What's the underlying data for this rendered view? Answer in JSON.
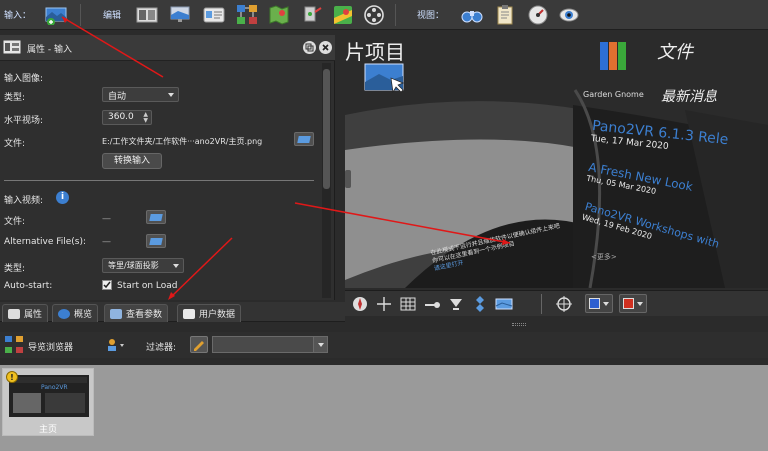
{
  "toolbar": {
    "input_label": "输入：",
    "edit_label": "编辑",
    "view_label": "视图："
  },
  "properties": {
    "title": "属性 - 输入",
    "input_image_label": "输入图像:",
    "type_label": "类型:",
    "type_value": "自动",
    "hfov_label": "水平视场:",
    "hfov_value": "360.0",
    "file_label": "文件:",
    "file_value": "E:/工作文件夹/工作软件···ano2VR/主页.png",
    "convert_button": "转换输入",
    "input_video_label": "输入视频:",
    "video_file_label": "文件:",
    "video_file_value": "—",
    "alt_files_label": "Alternative File(s):",
    "alt_files_value": "—",
    "video_type_label": "类型:",
    "video_type_value": "等里/球面投影",
    "autostart_label": "Auto-start:",
    "autostart_value": "Start on Load"
  },
  "tabs": [
    {
      "label": "属性"
    },
    {
      "label": "概览"
    },
    {
      "label": "查看参数"
    },
    {
      "label": "用户数据"
    }
  ],
  "viewer": {
    "project_text": "片项目",
    "files_text": "文件",
    "news_title_prefix": "Garden Gnome",
    "news_title": "最新消息",
    "news": [
      {
        "title": "Pano2VR 6.1.3 Rele",
        "date": "Tue, 17 Mar 2020"
      },
      {
        "title": "A Fresh New Look",
        "date": "Thu, 05 Mar 2020"
      },
      {
        "title": "Pano2VR Workshops with",
        "date": "Wed, 19 Feb 2020"
      }
    ],
    "more_link": "<更多>",
    "caption_line1": "在此模式下运行并且缩放软件以便确认组件上来吧",
    "caption_line2": "你可以在这里看到一个示例项目",
    "caption_link": "请这里打开"
  },
  "browser": {
    "title": "导览浏览器",
    "filter_label": "过滤器:",
    "filter_value": "",
    "thumb_label": "主页",
    "thumb_badge": "!",
    "thumb_title": "Pano2VR"
  },
  "colors": {
    "accent": "#5b9be0",
    "toolbar_label": "#cfe0ff"
  }
}
